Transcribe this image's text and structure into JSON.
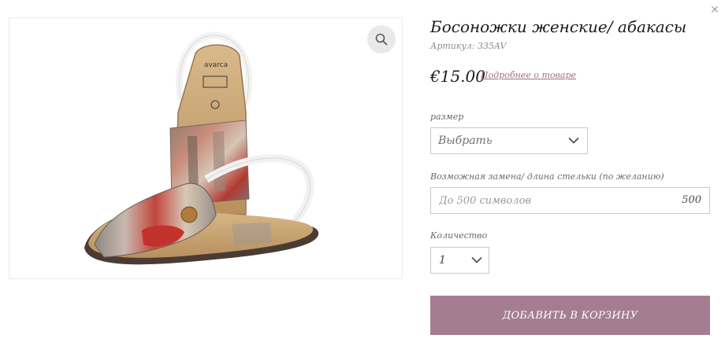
{
  "product": {
    "title": "Босоножки женские/ абакасы",
    "sku_label": "Артикул:",
    "sku_value": "335AV",
    "price": "€15.00",
    "details_link": "Подробнее о товаре",
    "image_brand": "avarca"
  },
  "options": {
    "size_label": "размер",
    "size_value": "Выбрать",
    "replacement_label": "Возможная замена/ длина стельки (по желанию)",
    "replacement_placeholder": "До 500 символов",
    "replacement_counter": "500",
    "quantity_label": "Количество",
    "quantity_value": "1"
  },
  "actions": {
    "add_to_cart": "ДОБАВИТЬ В КОРЗИНУ"
  },
  "icons": {
    "close": "close-icon",
    "zoom": "magnifier-icon",
    "dropdown": "chevron-down-icon"
  },
  "colors": {
    "accent": "#a57d93",
    "link": "#9c7088",
    "border": "#c9c9c9"
  }
}
